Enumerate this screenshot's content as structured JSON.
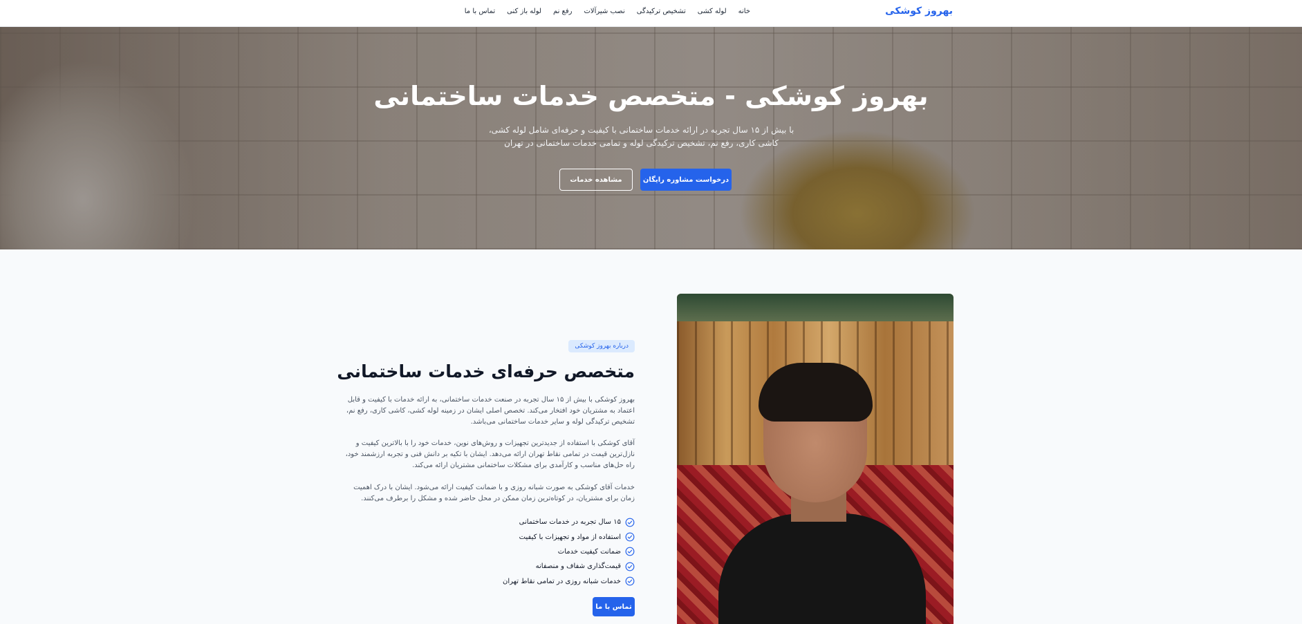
{
  "header": {
    "brand": "بهروز کوشکی",
    "nav": [
      "خانه",
      "لوله کشی",
      "تشخیص ترکیدگی",
      "نصب شیرآلات",
      "رفع نم",
      "لوله باز کنی",
      "تماس با ما"
    ]
  },
  "hero": {
    "title": "بهروز کوشکی - متخصص خدمات ساختمانی",
    "subtitle": "با بیش از ۱۵ سال تجربه در ارائه خدمات ساختمانی با کیفیت و حرفه‌ای شامل لوله کشی، کاشی کاری، رفع نم، تشخیص ترکیدگی لوله و تمامی خدمات ساختمانی در تهران",
    "primary_button": "درخواست مشاوره رایگان",
    "secondary_button": "مشاهده خدمات"
  },
  "about": {
    "badge": "درباره بهروز کوشکی",
    "title": "متخصص حرفه‌ای خدمات ساختمانی",
    "paragraphs": [
      "بهروز کوشکی با بیش از ۱۵ سال تجربه در صنعت خدمات ساختمانی، به ارائه خدمات با کیفیت و قابل اعتماد به مشتریان خود افتخار می‌کند. تخصص اصلی ایشان در زمینه لوله کشی، کاشی کاری، رفع نم، تشخیص ترکیدگی لوله و سایر خدمات ساختمانی می‌باشد.",
      "آقای کوشکی با استفاده از جدیدترین تجهیزات و روش‌های نوین، خدمات خود را با بالاترین کیفیت و نازل‌ترین قیمت در تمامی نقاط تهران ارائه می‌دهد. ایشان با تکیه بر دانش فنی و تجربه ارزشمند خود، راه حل‌های مناسب و کارآمدی برای مشکلات ساختمانی مشتریان ارائه می‌کند.",
      "خدمات آقای کوشکی به صورت شبانه روزی و با ضمانت کیفیت ارائه می‌شود. ایشان با درک اهمیت زمان برای مشتریان، در کوتاه‌ترین زمان ممکن در محل حاضر شده و مشکل را برطرف می‌کنند."
    ],
    "features": [
      "۱۵ سال تجربه در خدمات ساختمانی",
      "استفاده از مواد و تجهیزات با کیفیت",
      "ضمانت کیفیت خدمات",
      "قیمت‌گذاری شفاف و منصفانه",
      "خدمات شبانه روزی در تمامی نقاط تهران"
    ],
    "contact_button": "تماس با ما"
  },
  "colors": {
    "accent": "#2563eb",
    "badge_bg": "#dbeafe",
    "page_bg": "#f8fafc"
  },
  "icons": {
    "feature_icon": "check-circle-icon"
  }
}
